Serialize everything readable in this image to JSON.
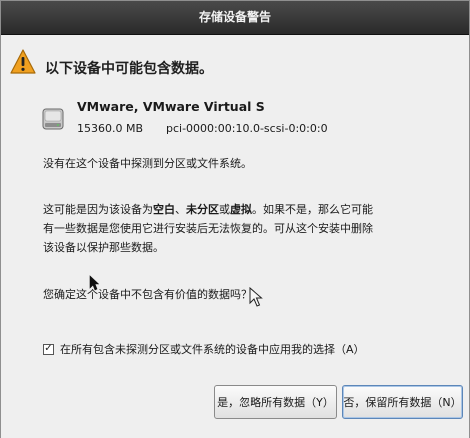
{
  "window": {
    "title": "存储设备警告"
  },
  "dialog": {
    "heading": "以下设备中可能包含数据。",
    "device": {
      "name": "VMware, VMware Virtual S",
      "size": "15360.0 MB",
      "path": "pci-0000:00:10.0-scsi-0:0:0:0"
    },
    "message1": "没有在这个设备中探测到分区或文件系统。",
    "message2": {
      "line1_prefix": "这可能是因为该设备为",
      "bold1": "空白",
      "sep1": "、",
      "bold2": "未分区",
      "sep2": "或",
      "bold3": "虚拟",
      "line1_suffix": "。如果不是，那么它可能",
      "line2": "有一些数据是您使用它进行安装后无法恢复的。可从这个安装中删除",
      "line3": "该设备以保护那些数据。"
    },
    "question": "您确定这个设备中不包含有价值的数据吗？",
    "apply_all": {
      "checked": true,
      "check_glyph": "✓",
      "label": "在所有包含未探测分区或文件系统的设备中应用我的选择（A）"
    }
  },
  "buttons": {
    "ignore_label": "是，忽略所有数据（Y）",
    "keep_label": "否，保留所有数据（N）"
  },
  "colors": {
    "warning_fill": "#f0a020",
    "titlebar": "#2f2f2f",
    "default_button_border": "#5c86b8"
  },
  "icons": {
    "warning": "warning-triangle-icon",
    "disk": "hard-disk-icon",
    "cursor": "mouse-pointer-icon"
  }
}
